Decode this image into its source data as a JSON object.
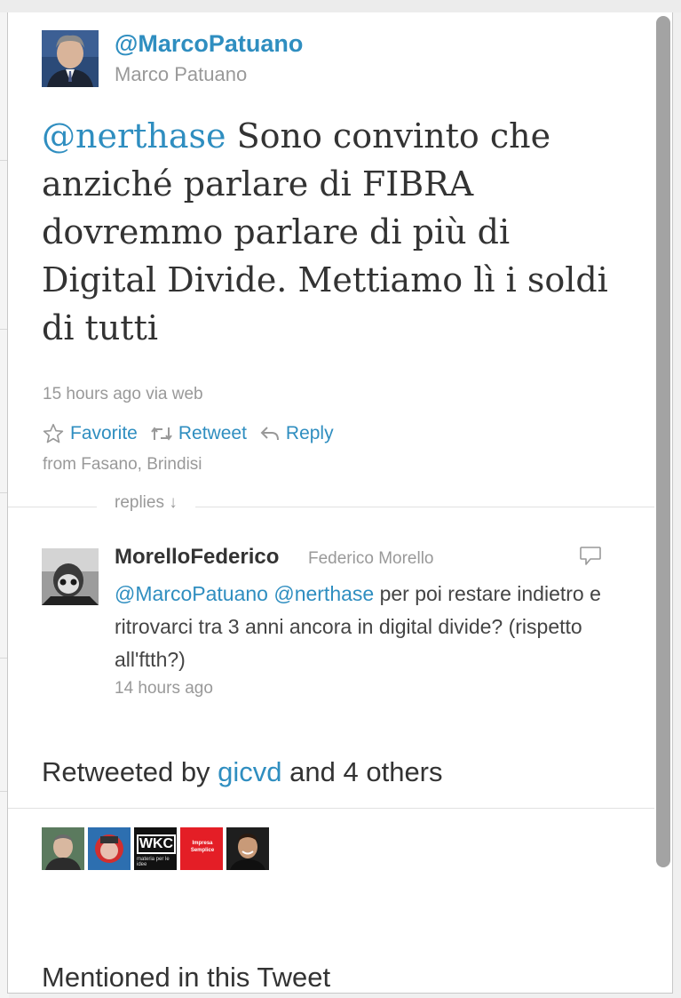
{
  "tweet": {
    "handle": "@MarcoPatuano",
    "full_name": "Marco Patuano",
    "mention": "@nerthase",
    "text": " Sono convinto che anziché parlare di FIBRA dovremmo parlare di più di Digital Divide. Mettiamo lì i soldi di tutti",
    "time": "15 hours ago via web",
    "location": "from Fasano, Brindisi",
    "actions": {
      "favorite": "Favorite",
      "retweet": "Retweet",
      "reply": "Reply"
    }
  },
  "replies": {
    "label": "replies ↓",
    "items": [
      {
        "username": "MorelloFederico",
        "full_name": "Federico Morello",
        "mention1": "@MarcoPatuano",
        "mention2": "@nerthase",
        "text": " per poi restare indietro e ritrovarci tra 3 anni ancora in digital divide? (rispetto all'ftth?)",
        "time": "14 hours ago"
      }
    ]
  },
  "retweets": {
    "prefix": "Retweeted by ",
    "user": "gicvd",
    "suffix": " and 4 others",
    "avatar_labels": {
      "wkc": "WKC",
      "wkc_sub": "materia per le idee",
      "red": "Impresa Semplice"
    }
  },
  "mentioned": {
    "title": "Mentioned in this Tweet"
  },
  "colors": {
    "link": "#2f8ec0",
    "muted": "#999999",
    "text": "#333333",
    "accent_red": "#e41e26"
  }
}
